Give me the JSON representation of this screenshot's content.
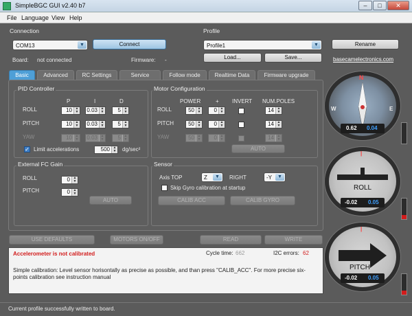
{
  "window": {
    "title": "SimpleBGC GUI v2.40 b7",
    "min_glyph": "–",
    "max_glyph": "□",
    "close_glyph": "✕"
  },
  "menu": {
    "items": [
      "File",
      "Language",
      "View",
      "Help"
    ]
  },
  "connection": {
    "title": "Connection",
    "port": "COM13",
    "connect_label": "Connect",
    "board_label": "Board:",
    "board_value": "not connected",
    "firmware_label": "Firmware:",
    "firmware_value": "-"
  },
  "profile": {
    "title": "Profile",
    "selected": "Profile1",
    "load_label": "Load...",
    "save_label": "Save...",
    "rename_label": "Rename",
    "link": "basecamelectronics.com"
  },
  "tabs": [
    "Basic",
    "Advanced",
    "RC Settings",
    "Service",
    "Follow mode",
    "Realtime Data",
    "Firmware upgrade"
  ],
  "pid": {
    "title": "PID Controller",
    "headers": [
      "P",
      "I",
      "D"
    ],
    "rows": [
      {
        "label": "ROLL",
        "p": "10",
        "i": "0.03",
        "d": "5"
      },
      {
        "label": "PITCH",
        "p": "10",
        "i": "0.03",
        "d": "5"
      },
      {
        "label": "YAW",
        "p": "10",
        "i": "0.03",
        "d": "5"
      }
    ],
    "limit_label": "Limit accelerations",
    "limit_value": "500",
    "limit_unit": "dg/sec²"
  },
  "motor": {
    "title": "Motor Configuration",
    "headers": [
      "POWER",
      "+",
      "INVERT",
      "NUM.POLES"
    ],
    "rows": [
      {
        "label": "ROLL",
        "power": "50",
        "plus": "0",
        "poles": "14"
      },
      {
        "label": "PITCH",
        "power": "50",
        "plus": "0",
        "poles": "14"
      },
      {
        "label": "YAW",
        "power": "50",
        "plus": "0",
        "poles": "14"
      }
    ],
    "auto_label": "AUTO"
  },
  "extfc": {
    "title": "External FC Gain",
    "rows": [
      {
        "label": "ROLL",
        "value": "0"
      },
      {
        "label": "PITCH",
        "value": "0"
      }
    ],
    "auto_label": "AUTO"
  },
  "sensor": {
    "title": "Sensor",
    "axis_top_label": "Axis TOP",
    "axis_top_value": "Z",
    "right_label": "RIGHT",
    "right_value": "-Y",
    "skip_label": "Skip Gyro calibration at startup",
    "calib_acc": "CALIB ACC",
    "calib_gyro": "CALIB GYRO"
  },
  "actions": {
    "use_defaults": "USE DEFAULTS",
    "motors": "MOTORS ON/OFF",
    "read": "READ",
    "write": "WRITE"
  },
  "stats": {
    "cycle_label": "Cycle time:",
    "cycle_value": "662",
    "i2c_label": "I2C errors:",
    "i2c_value": "62"
  },
  "message": {
    "alert": "Accelerometer is not calibrated",
    "text": "Simple calibration: Level sensor horisontally as precise as possible, and than press \"CALIB_ACC\". For more precise six-points calibration see instruction manual"
  },
  "gauges": {
    "compass": {
      "n": "N",
      "e": "E",
      "w": "W",
      "value_a": "0.62",
      "value_b": "0.04",
      "bar_level": 0
    },
    "roll": {
      "label": "ROLL",
      "value_a": "-0.02",
      "value_b": "0.05",
      "bar_level": 0.2
    },
    "pitch": {
      "label": "PITCH",
      "value_a": "-0.02",
      "value_b": "0.05",
      "bar_level": 0.2
    }
  },
  "status": "Current profile successfully written to board.",
  "colors": {
    "accent": "#4e9fd7",
    "alert": "#d21c1c",
    "readout_a": "#ffffff",
    "readout_b": "#3fa0ff"
  }
}
